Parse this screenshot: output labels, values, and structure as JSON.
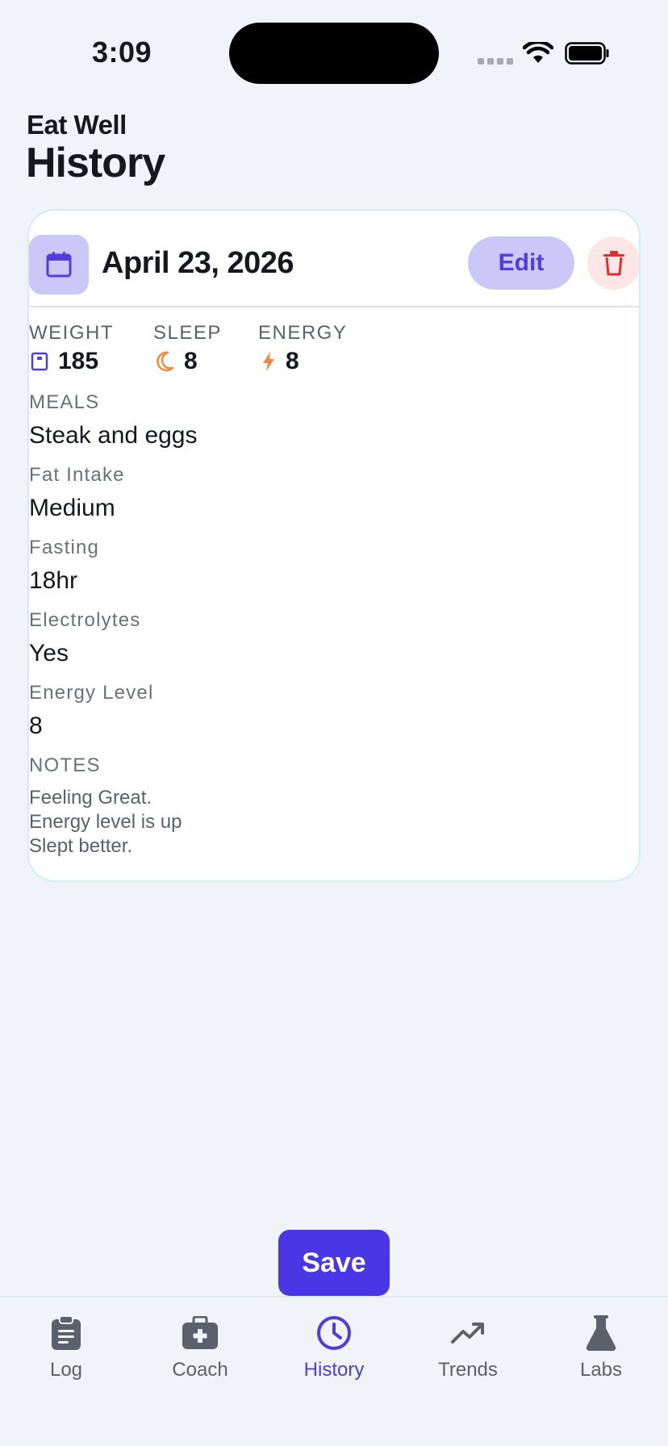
{
  "status_bar": {
    "time": "3:09"
  },
  "header": {
    "app_title": "Eat Well",
    "page_title": "History"
  },
  "entry": {
    "date": "April 23, 2026",
    "edit_label": "Edit",
    "stats": [
      {
        "label": "WEIGHT",
        "value": "185",
        "icon": "scale-icon"
      },
      {
        "label": "SLEEP",
        "value": "8",
        "icon": "moon-icon"
      },
      {
        "label": "ENERGY",
        "value": "8",
        "icon": "bolt-icon"
      }
    ],
    "fields": [
      {
        "label": "MEALS",
        "value": "Steak and eggs"
      },
      {
        "label": "Fat Intake",
        "value": "Medium"
      },
      {
        "label": "Fasting",
        "value": "18hr"
      },
      {
        "label": "Electrolytes",
        "value": "Yes"
      },
      {
        "label": "Energy Level",
        "value": "8"
      }
    ],
    "notes_label": "NOTES",
    "notes": [
      "Feeling Great.",
      "Energy level is up",
      "Slept better."
    ]
  },
  "save_label": "Save",
  "tabs": [
    {
      "label": "Log",
      "icon": "clipboard-icon",
      "active": false
    },
    {
      "label": "Coach",
      "icon": "medkit-icon",
      "active": false
    },
    {
      "label": "History",
      "icon": "clock-icon",
      "active": true
    },
    {
      "label": "Trends",
      "icon": "trend-icon",
      "active": false
    },
    {
      "label": "Labs",
      "icon": "flask-icon",
      "active": false
    }
  ],
  "colors": {
    "accent": "#4936e4",
    "accent_soft": "#cbc7f7",
    "danger": "#d93030",
    "danger_soft": "#fde6e6",
    "sleep": "#f0883e",
    "energy": "#f0883e",
    "background": "#f0f3f8"
  }
}
